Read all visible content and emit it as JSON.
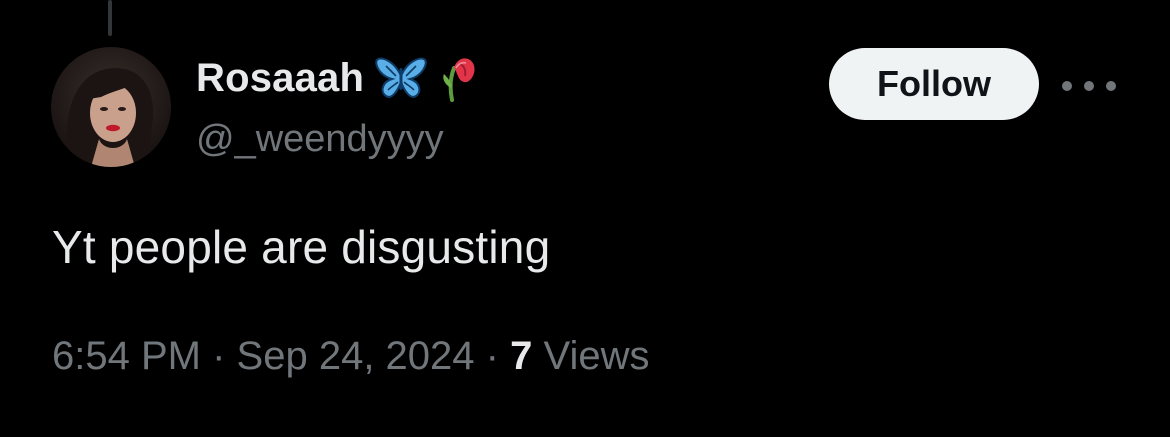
{
  "tweet": {
    "author": {
      "display_name": "Rosaaah",
      "name_emojis": [
        "butterfly-emoji",
        "wilted-rose-emoji"
      ],
      "handle": "@_weendyyyy"
    },
    "follow_label": "Follow",
    "more_icon": "more-horizontal-icon",
    "text": "Yt people are disgusting",
    "meta": {
      "time": "6:54 PM",
      "separator": "·",
      "date": "Sep 24, 2024",
      "views_count": "7",
      "views_label": "Views"
    }
  },
  "colors": {
    "background": "#000000",
    "primary_text": "#e7e9ea",
    "secondary_text": "#71767b",
    "follow_bg": "#eff3f4",
    "follow_text": "#0f1419"
  }
}
